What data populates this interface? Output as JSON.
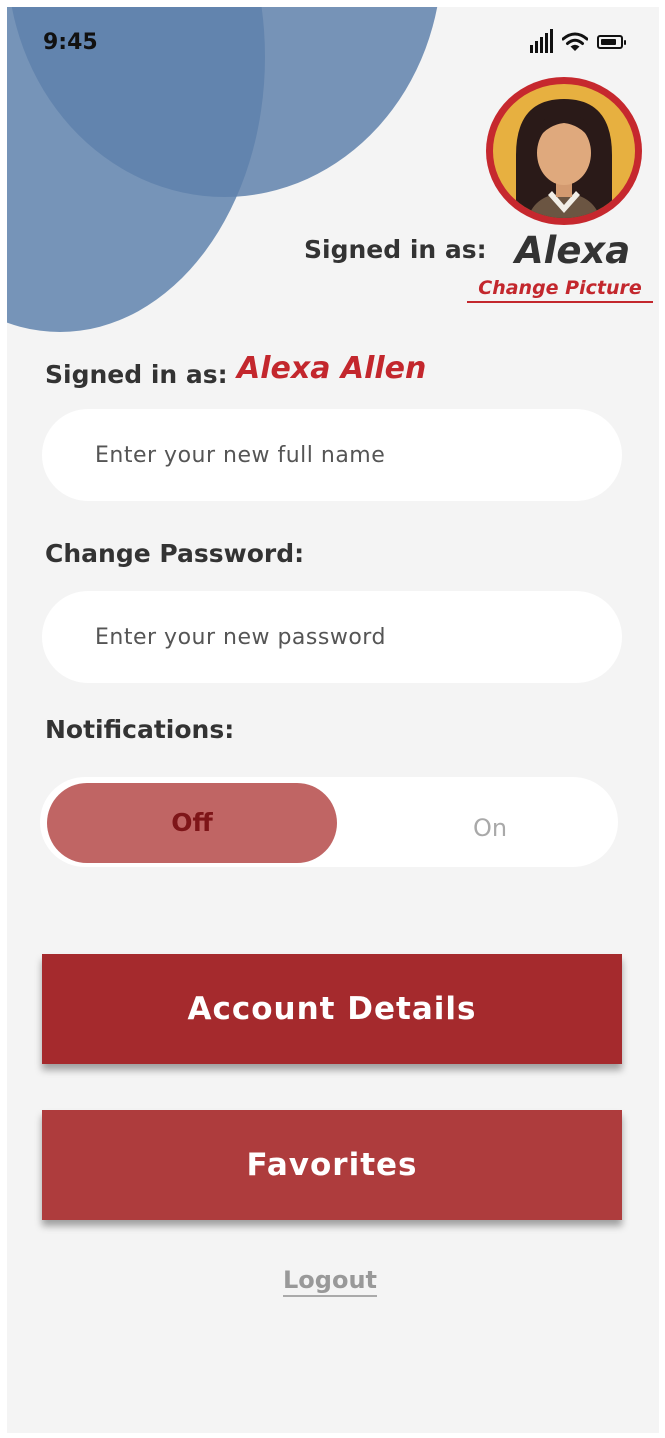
{
  "status_bar": {
    "time": "9:45",
    "icons": [
      "signal-icon",
      "wifi-icon",
      "battery-icon"
    ]
  },
  "profile": {
    "signed_in_label": "Signed in as:",
    "short_name": "Alexa",
    "change_picture": "Change Picture",
    "full_name": "Alexa Allen"
  },
  "form": {
    "name_placeholder": "Enter your new full name",
    "password_label": "Change Password:",
    "password_placeholder": "Enter your new password",
    "notifications_label": "Notifications:",
    "toggle_off": "Off",
    "toggle_on": "On",
    "notifications_selected": "Off"
  },
  "buttons": {
    "account_details": "Account Details",
    "favorites": "Favorites",
    "logout": "Logout"
  },
  "colors": {
    "accent_red": "#a52a2d",
    "link_red": "#c3272d",
    "blob_blue": "#6a8bb2",
    "background": "#f4f4f4"
  }
}
